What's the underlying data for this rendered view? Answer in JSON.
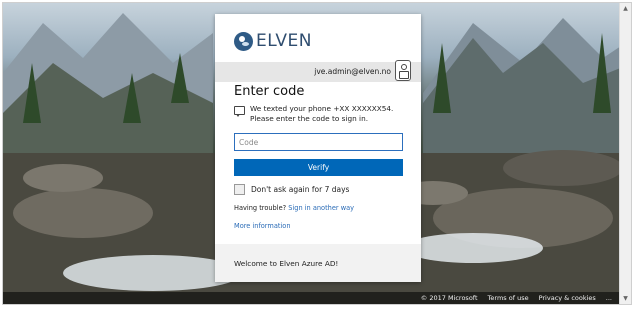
{
  "brand": {
    "logo_text": "ELVEN",
    "logo_icon": "elven-logo-icon",
    "accent": "#0067b8"
  },
  "user": {
    "email": "jve.admin@elven.no",
    "icon": "badge-icon"
  },
  "page": {
    "title": "Enter code",
    "message_icon": "message-icon",
    "message": "We texted your phone +XX XXXXXX54. Please enter the code to sign in."
  },
  "form": {
    "code_placeholder": "Code",
    "code_value": "",
    "verify_label": "Verify",
    "remember_label": "Don't ask again for 7 days",
    "remember_checked": false
  },
  "help": {
    "trouble_prefix": "Having trouble?",
    "trouble_link": "Sign in another way",
    "more_info": "More information"
  },
  "card_footer": {
    "welcome": "Welcome to Elven Azure AD!"
  },
  "footer": {
    "copyright": "© 2017 Microsoft",
    "terms": "Terms of use",
    "privacy": "Privacy & cookies",
    "more": "..."
  }
}
